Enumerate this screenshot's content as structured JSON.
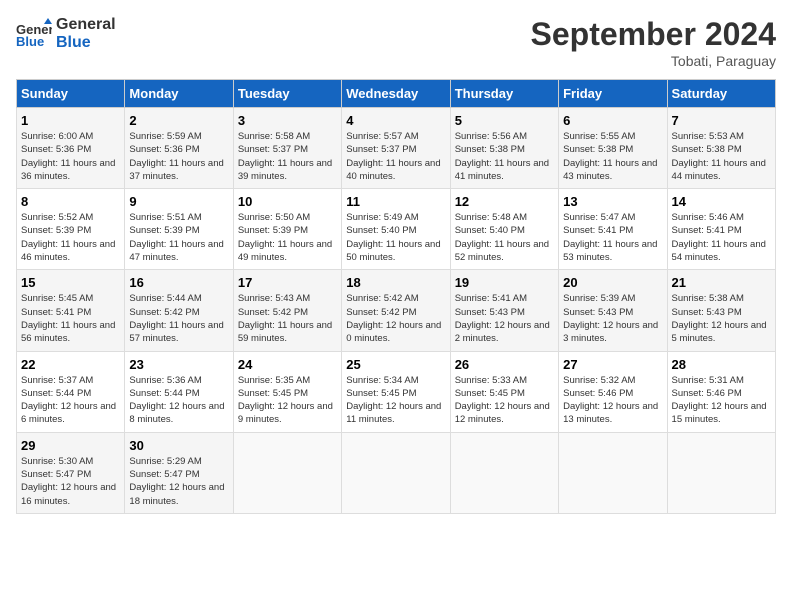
{
  "header": {
    "logo_line1": "General",
    "logo_line2": "Blue",
    "month": "September 2024",
    "location": "Tobati, Paraguay"
  },
  "weekdays": [
    "Sunday",
    "Monday",
    "Tuesday",
    "Wednesday",
    "Thursday",
    "Friday",
    "Saturday"
  ],
  "weeks": [
    [
      {
        "day": "1",
        "sunrise": "6:00 AM",
        "sunset": "5:36 PM",
        "daylight": "11 hours and 36 minutes."
      },
      {
        "day": "2",
        "sunrise": "5:59 AM",
        "sunset": "5:36 PM",
        "daylight": "11 hours and 37 minutes."
      },
      {
        "day": "3",
        "sunrise": "5:58 AM",
        "sunset": "5:37 PM",
        "daylight": "11 hours and 39 minutes."
      },
      {
        "day": "4",
        "sunrise": "5:57 AM",
        "sunset": "5:37 PM",
        "daylight": "11 hours and 40 minutes."
      },
      {
        "day": "5",
        "sunrise": "5:56 AM",
        "sunset": "5:38 PM",
        "daylight": "11 hours and 41 minutes."
      },
      {
        "day": "6",
        "sunrise": "5:55 AM",
        "sunset": "5:38 PM",
        "daylight": "11 hours and 43 minutes."
      },
      {
        "day": "7",
        "sunrise": "5:53 AM",
        "sunset": "5:38 PM",
        "daylight": "11 hours and 44 minutes."
      }
    ],
    [
      {
        "day": "8",
        "sunrise": "5:52 AM",
        "sunset": "5:39 PM",
        "daylight": "11 hours and 46 minutes."
      },
      {
        "day": "9",
        "sunrise": "5:51 AM",
        "sunset": "5:39 PM",
        "daylight": "11 hours and 47 minutes."
      },
      {
        "day": "10",
        "sunrise": "5:50 AM",
        "sunset": "5:39 PM",
        "daylight": "11 hours and 49 minutes."
      },
      {
        "day": "11",
        "sunrise": "5:49 AM",
        "sunset": "5:40 PM",
        "daylight": "11 hours and 50 minutes."
      },
      {
        "day": "12",
        "sunrise": "5:48 AM",
        "sunset": "5:40 PM",
        "daylight": "11 hours and 52 minutes."
      },
      {
        "day": "13",
        "sunrise": "5:47 AM",
        "sunset": "5:41 PM",
        "daylight": "11 hours and 53 minutes."
      },
      {
        "day": "14",
        "sunrise": "5:46 AM",
        "sunset": "5:41 PM",
        "daylight": "11 hours and 54 minutes."
      }
    ],
    [
      {
        "day": "15",
        "sunrise": "5:45 AM",
        "sunset": "5:41 PM",
        "daylight": "11 hours and 56 minutes."
      },
      {
        "day": "16",
        "sunrise": "5:44 AM",
        "sunset": "5:42 PM",
        "daylight": "11 hours and 57 minutes."
      },
      {
        "day": "17",
        "sunrise": "5:43 AM",
        "sunset": "5:42 PM",
        "daylight": "11 hours and 59 minutes."
      },
      {
        "day": "18",
        "sunrise": "5:42 AM",
        "sunset": "5:42 PM",
        "daylight": "12 hours and 0 minutes."
      },
      {
        "day": "19",
        "sunrise": "5:41 AM",
        "sunset": "5:43 PM",
        "daylight": "12 hours and 2 minutes."
      },
      {
        "day": "20",
        "sunrise": "5:39 AM",
        "sunset": "5:43 PM",
        "daylight": "12 hours and 3 minutes."
      },
      {
        "day": "21",
        "sunrise": "5:38 AM",
        "sunset": "5:43 PM",
        "daylight": "12 hours and 5 minutes."
      }
    ],
    [
      {
        "day": "22",
        "sunrise": "5:37 AM",
        "sunset": "5:44 PM",
        "daylight": "12 hours and 6 minutes."
      },
      {
        "day": "23",
        "sunrise": "5:36 AM",
        "sunset": "5:44 PM",
        "daylight": "12 hours and 8 minutes."
      },
      {
        "day": "24",
        "sunrise": "5:35 AM",
        "sunset": "5:45 PM",
        "daylight": "12 hours and 9 minutes."
      },
      {
        "day": "25",
        "sunrise": "5:34 AM",
        "sunset": "5:45 PM",
        "daylight": "12 hours and 11 minutes."
      },
      {
        "day": "26",
        "sunrise": "5:33 AM",
        "sunset": "5:45 PM",
        "daylight": "12 hours and 12 minutes."
      },
      {
        "day": "27",
        "sunrise": "5:32 AM",
        "sunset": "5:46 PM",
        "daylight": "12 hours and 13 minutes."
      },
      {
        "day": "28",
        "sunrise": "5:31 AM",
        "sunset": "5:46 PM",
        "daylight": "12 hours and 15 minutes."
      }
    ],
    [
      {
        "day": "29",
        "sunrise": "5:30 AM",
        "sunset": "5:47 PM",
        "daylight": "12 hours and 16 minutes."
      },
      {
        "day": "30",
        "sunrise": "5:29 AM",
        "sunset": "5:47 PM",
        "daylight": "12 hours and 18 minutes."
      },
      null,
      null,
      null,
      null,
      null
    ]
  ]
}
